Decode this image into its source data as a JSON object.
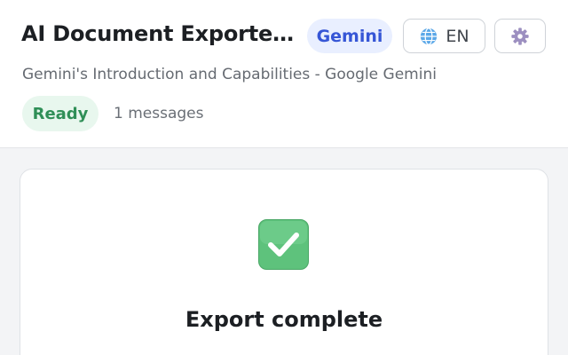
{
  "header": {
    "title": "AI Document Exporter Export",
    "provider_badge": "Gemini",
    "language_label": "EN",
    "subtitle": "Gemini's Introduction and Capabilities - Google Gemini",
    "status": "Ready",
    "message_count": "1 messages"
  },
  "result": {
    "title": "Export complete"
  },
  "icons": {
    "language": "globe-icon",
    "settings": "gear-icon",
    "result": "check-mark-icon"
  },
  "colors": {
    "provider_badge_bg": "#e9efff",
    "provider_badge_text": "#3656d6",
    "status_bg": "#e8f7ee",
    "status_text": "#2f8f57",
    "check_green": "#5ec27c"
  }
}
